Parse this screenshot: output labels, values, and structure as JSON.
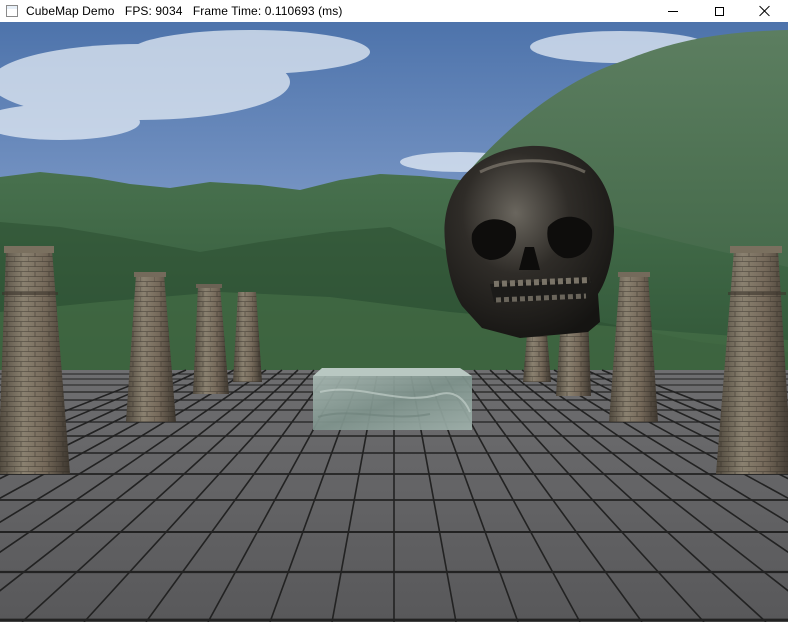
{
  "window": {
    "title_left": "CubeMap Demo",
    "fps_label": "FPS: 9034",
    "frame_time_label": "Frame Time: 0.110693 (ms)",
    "controls": [
      "minimize-icon",
      "maximize-icon",
      "close-icon"
    ]
  },
  "scene": {
    "objects": [
      "sky",
      "mountains",
      "tiled-floor",
      "stone-pillar",
      "skull",
      "glass-box"
    ],
    "colors": {
      "sky": "#5a7fb5",
      "mountain": "#3e6b45",
      "floor": "#5e5e5f",
      "grout": "#1f1f1f",
      "pillar": "#6b6254",
      "skull": "#2a2825",
      "glass": "#8ea39d"
    }
  }
}
